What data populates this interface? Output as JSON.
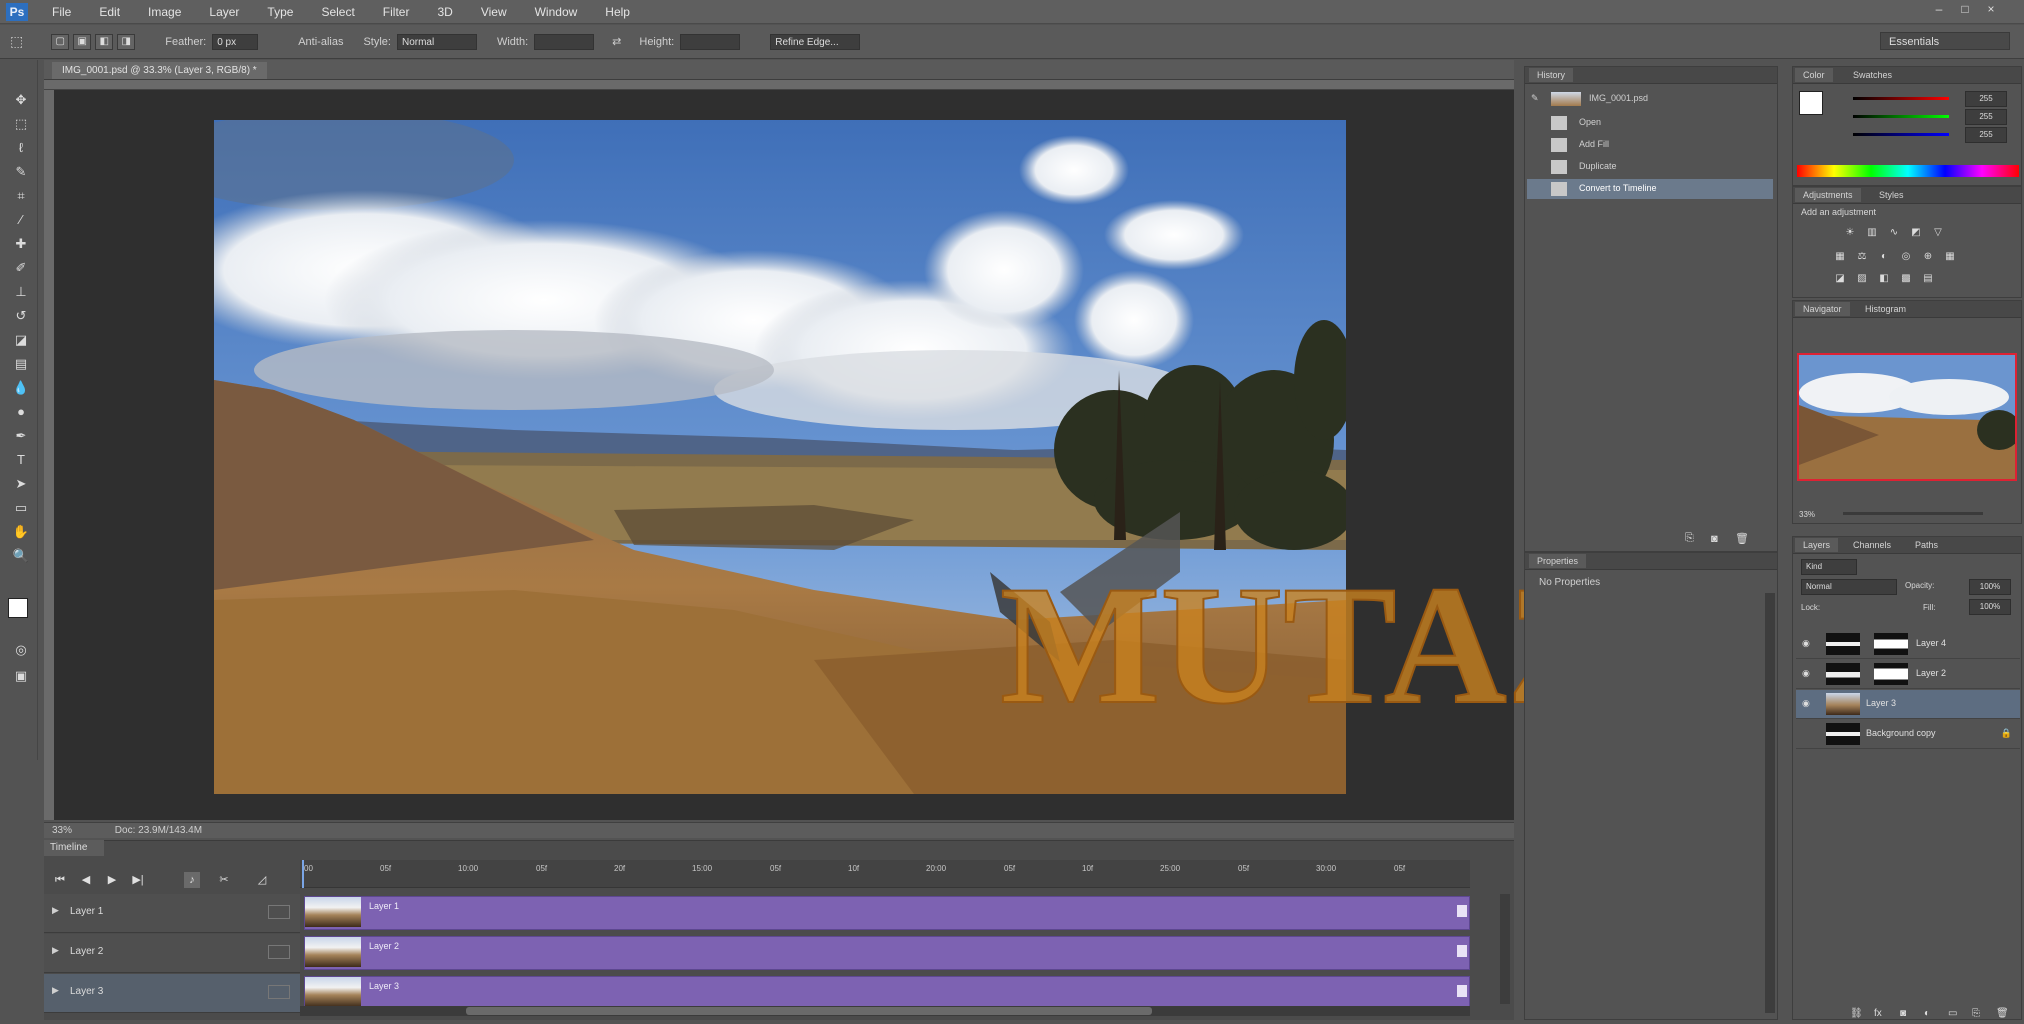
{
  "app": {
    "logo": "Ps",
    "menus": [
      "File",
      "Edit",
      "Image",
      "Layer",
      "Type",
      "Select",
      "Filter",
      "3D",
      "View",
      "Window",
      "Help"
    ],
    "window_controls": [
      "–",
      "□",
      "×"
    ]
  },
  "options_bar": {
    "feather_label": "Feather:",
    "feather_value": "0 px",
    "antialias_label": "Anti-alias",
    "style_label": "Style:",
    "style_value": "Normal",
    "width_label": "Width:",
    "height_label": "Height:",
    "refine_edge_label": "Refine Edge...",
    "workspace": "Essentials"
  },
  "document": {
    "tab_title": "IMG_0001.psd @ 33.3% (Layer 3, RGB/8) *",
    "zoom": "33%",
    "doc_size": "Doc: 23.9M/143.4M"
  },
  "watermark": "MUTAZ",
  "timeline": {
    "tab": "Timeline",
    "ticks": [
      "00",
      "05f",
      "10:00",
      "05f",
      "20f",
      "15:00",
      "05f",
      "10f",
      "20:00",
      "05f",
      "10f",
      "25:00",
      "05f",
      "30:00",
      "05f"
    ],
    "tracks": [
      {
        "name": "Layer 1",
        "clip": "Layer 1"
      },
      {
        "name": "Layer 2",
        "clip": "Layer 2"
      },
      {
        "name": "Layer 3",
        "clip": "Layer 3"
      }
    ],
    "clip_color": "#7d62b2"
  },
  "history": {
    "tab": "History",
    "snapshot": "IMG_0001.psd",
    "items": [
      "Open",
      "Add Fill",
      "Duplicate",
      "Convert to Timeline"
    ]
  },
  "color": {
    "tabs": [
      "Color",
      "Swatches"
    ],
    "values": [
      "255",
      "255",
      "255"
    ]
  },
  "adjustments": {
    "tabs": [
      "Adjustments",
      "Styles"
    ],
    "title": "Add an adjustment"
  },
  "navigator": {
    "tabs": [
      "Navigator",
      "Histogram"
    ],
    "zoom": "33%"
  },
  "properties": {
    "tab": "Properties",
    "text": "No Properties"
  },
  "layers": {
    "tabs": [
      "Layers",
      "Channels",
      "Paths"
    ],
    "kind": "Kind",
    "blend_mode": "Normal",
    "opacity_label": "Opacity:",
    "opacity": "100%",
    "lock_label": "Lock:",
    "fill_label": "Fill:",
    "fill": "100%",
    "rows": [
      "Layer 4",
      "Layer 2",
      "Layer 3",
      "Background copy"
    ]
  },
  "colors": {
    "accent_selection": "#6b7a8c",
    "watermark_fill": "#c9821f",
    "foreground": "#ffffff",
    "background": "#000000"
  }
}
